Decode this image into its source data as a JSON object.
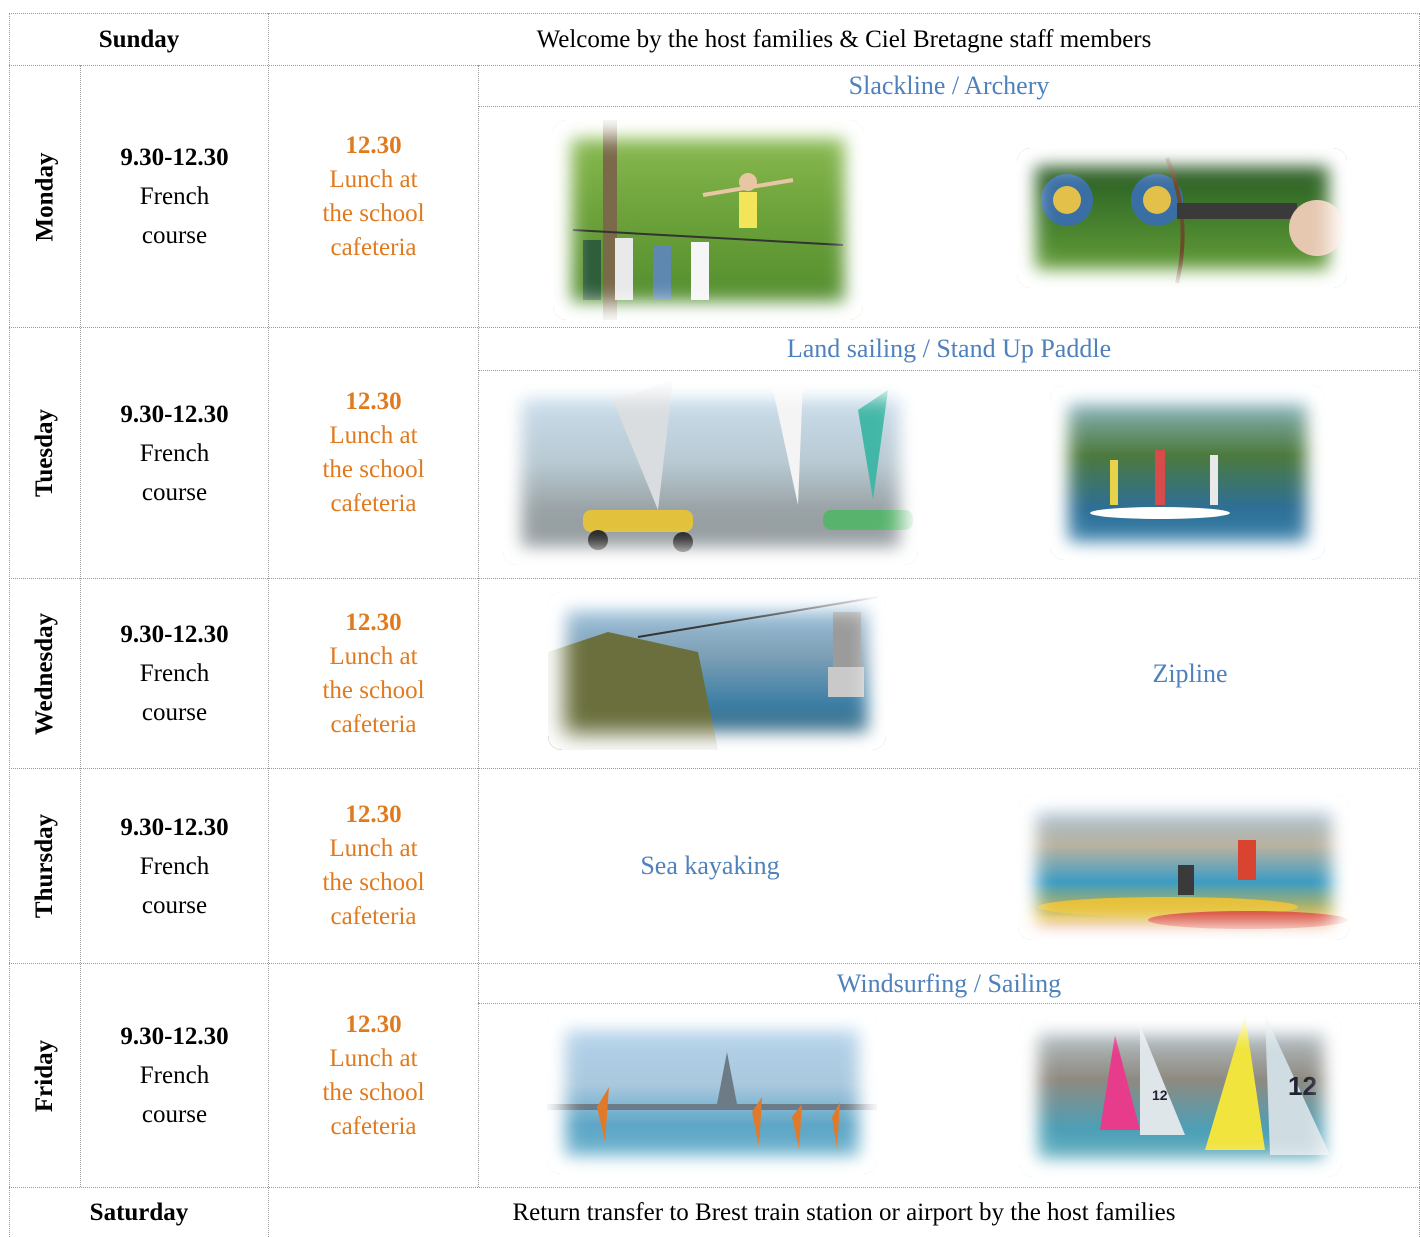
{
  "schedule": {
    "sunday": {
      "day": "Sunday",
      "text": "Welcome by the host families & Ciel Bretagne staff members"
    },
    "weekdays": [
      {
        "day": "Monday",
        "course_time": "9.30-12.30",
        "course_line1": "French",
        "course_line2": "course",
        "lunch_time": "12.30",
        "lunch_line1": "Lunch at",
        "lunch_line2": "the school",
        "lunch_line3": "cafeteria",
        "activity": "Slackline / Archery"
      },
      {
        "day": "Tuesday",
        "course_time": "9.30-12.30",
        "course_line1": "French",
        "course_line2": "course",
        "lunch_time": "12.30",
        "lunch_line1": "Lunch at",
        "lunch_line2": "the school",
        "lunch_line3": "cafeteria",
        "activity": "Land sailing / Stand Up Paddle"
      },
      {
        "day": "Wednesday",
        "course_time": "9.30-12.30",
        "course_line1": "French",
        "course_line2": "course",
        "lunch_time": "12.30",
        "lunch_line1": "Lunch at",
        "lunch_line2": "the school",
        "lunch_line3": "cafeteria",
        "activity": "Zipline"
      },
      {
        "day": "Thursday",
        "course_time": "9.30-12.30",
        "course_line1": "French",
        "course_line2": "course",
        "lunch_time": "12.30",
        "lunch_line1": "Lunch at",
        "lunch_line2": "the school",
        "lunch_line3": "cafeteria",
        "activity": "Sea kayaking"
      },
      {
        "day": "Friday",
        "course_time": "9.30-12.30",
        "course_line1": "French",
        "course_line2": "course",
        "lunch_time": "12.30",
        "lunch_line1": "Lunch at",
        "lunch_line2": "the school",
        "lunch_line3": "cafeteria",
        "activity": "Windsurfing / Sailing"
      }
    ],
    "saturday": {
      "day": "Saturday",
      "text": "Return transfer to Brest train station or airport by the host families"
    }
  },
  "photos": {
    "sail_number_a": "12",
    "sail_number_b": "12"
  },
  "colors": {
    "lunch": "#e07a1f",
    "activity": "#4f81bd",
    "grid": "#9a9a9a"
  }
}
